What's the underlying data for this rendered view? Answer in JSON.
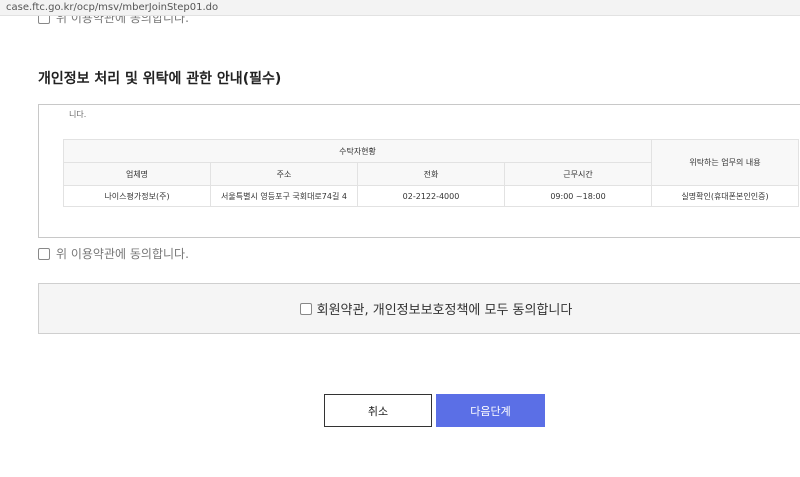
{
  "browser": {
    "url": "case.ftc.go.kr/ocp/msv/mberJoinStep01.do"
  },
  "top_agree": {
    "label": "위 이용약관에 동의합니다."
  },
  "privacy_section": {
    "title": "개인정보 처리 및 위탁에 관한 안내(필수)",
    "scroll_fragment": "니다.",
    "table": {
      "group_header": "수탁자현황",
      "task_header": "위탁하는 업무의 내용",
      "columns": [
        "업체명",
        "주소",
        "전화",
        "근무시간"
      ],
      "rows": [
        {
          "company": "나이스평가정보(주)",
          "address": "서울특별시 영등포구 국회대로74길 4",
          "phone": "02-2122-4000",
          "hours": "09:00 ~18:00",
          "task": "실명확인(휴대폰본인인증)"
        }
      ]
    },
    "agree_label": "위 이용약관에 동의합니다."
  },
  "all_agree": {
    "label": "회원약관, 개인정보보호정책에 모두 동의합니다"
  },
  "buttons": {
    "cancel": "취소",
    "next": "다음단계"
  }
}
